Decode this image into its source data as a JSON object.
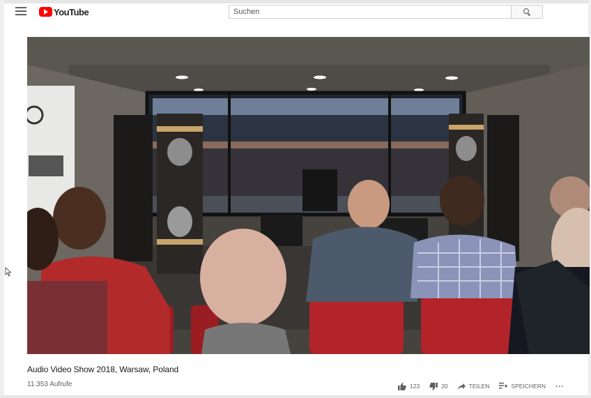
{
  "header": {
    "logo_text": "YouTube",
    "search_placeholder": "Suchen"
  },
  "video": {
    "title": "Audio Video Show 2018, Warsaw, Poland",
    "views": "11.353 Aufrufe"
  },
  "actions": {
    "likes": "123",
    "dislikes": "20",
    "share_label": "TEILEN",
    "save_label": "SPEICHERN",
    "more_label": "..."
  },
  "colors": {
    "brand_red": "#ff0000",
    "text_primary": "#1a1a1a",
    "text_secondary": "#606060"
  }
}
